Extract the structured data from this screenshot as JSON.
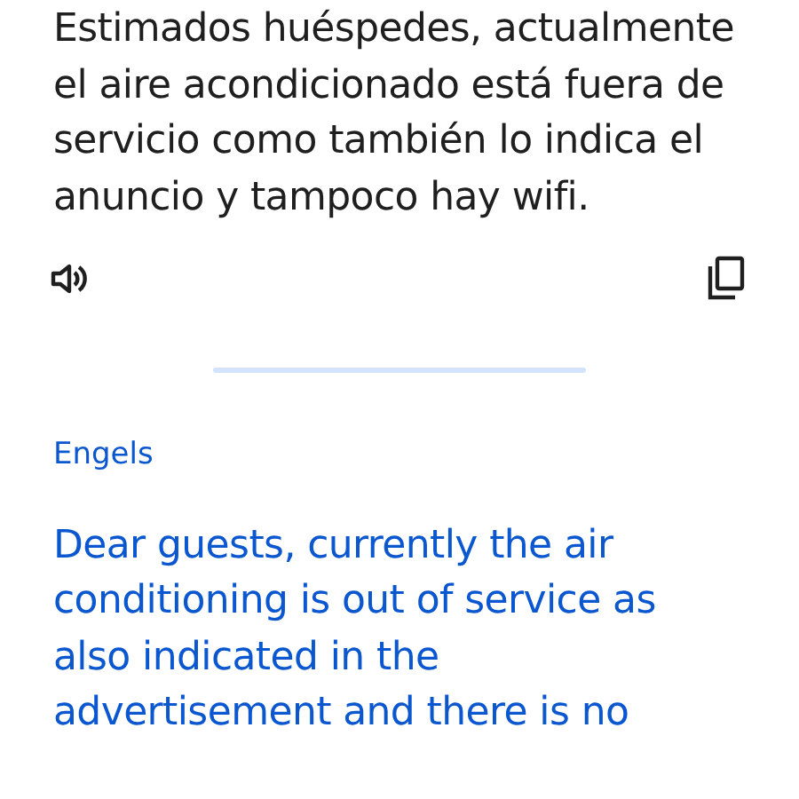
{
  "source": {
    "text": "Estimados huéspedes, actualmente el aire acondicionado está fuera de servicio como también lo indica el anuncio y tampoco hay wifi."
  },
  "target": {
    "language": "Engels",
    "text": "Dear guests, currently the air conditioning is out of service as also indicated in the advertisement and there is no"
  }
}
